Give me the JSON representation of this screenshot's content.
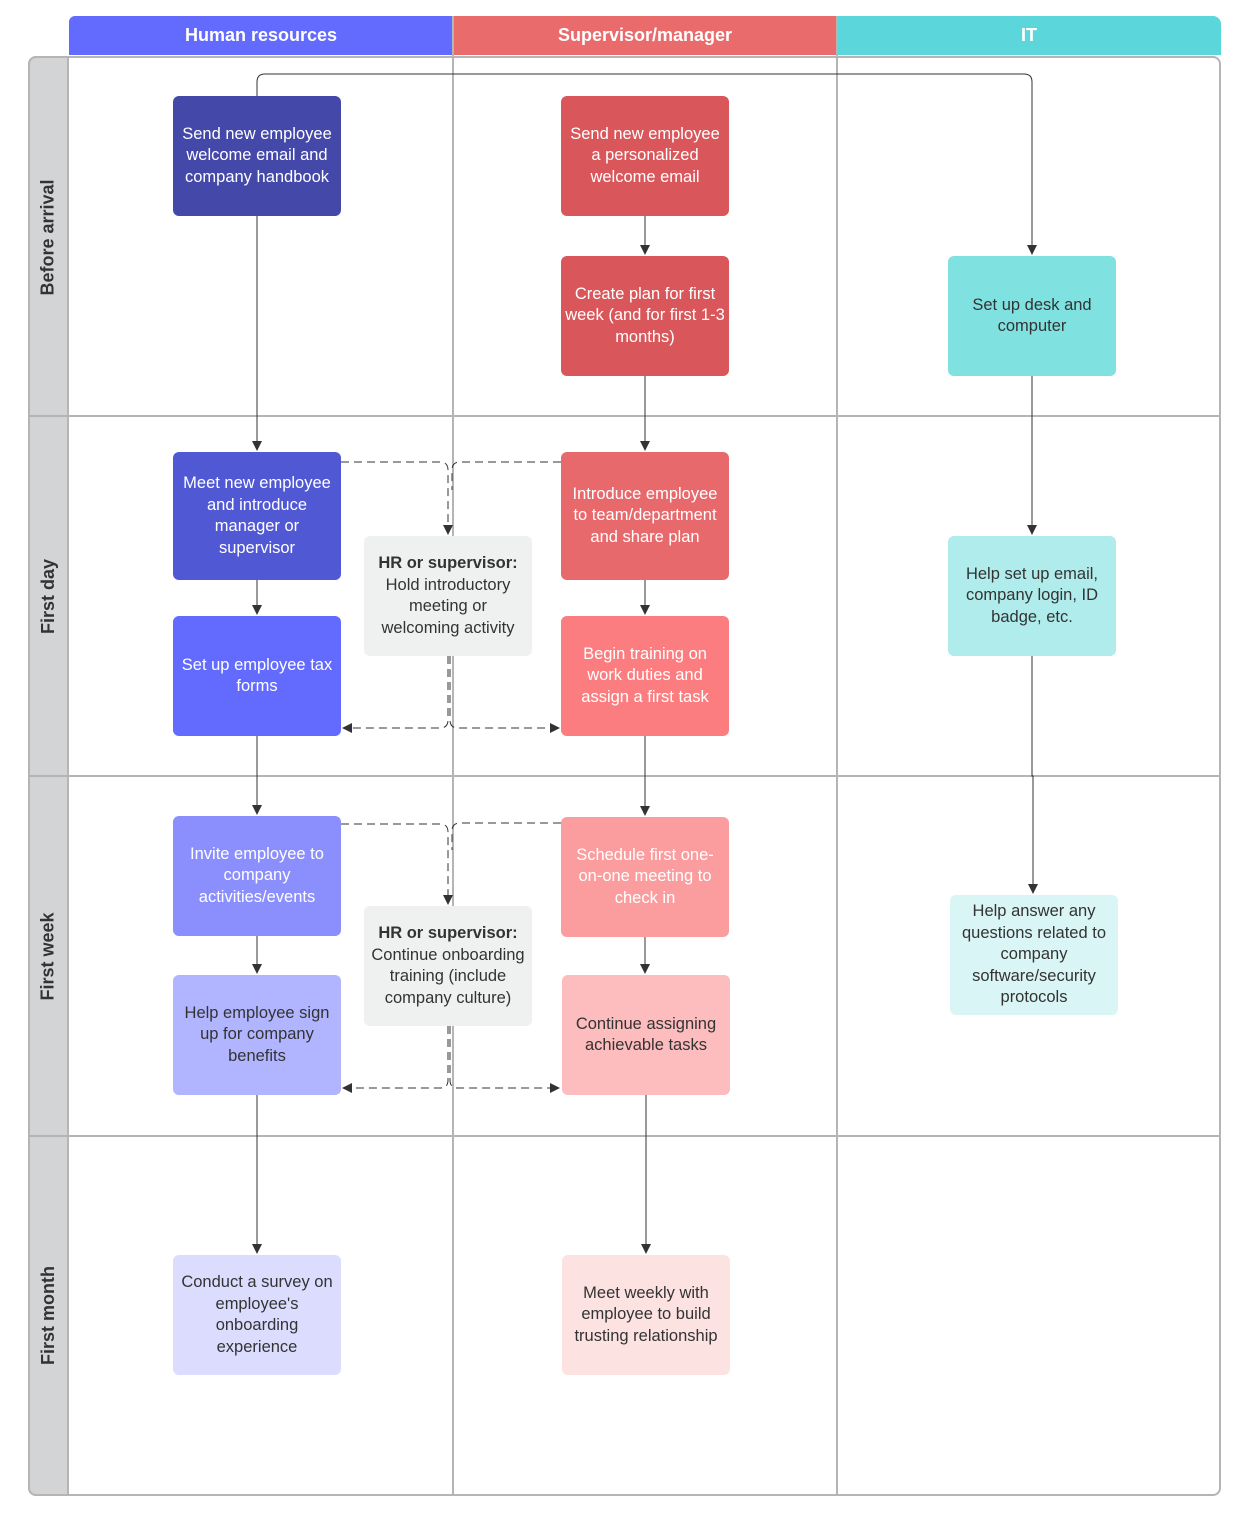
{
  "lanes": [
    {
      "id": "hr",
      "label": "Human resources",
      "color": "#636bff"
    },
    {
      "id": "sup",
      "label": "Supervisor/manager",
      "color": "#ea6b6b"
    },
    {
      "id": "it",
      "label": "IT",
      "color": "#5bd6da"
    }
  ],
  "phases": [
    {
      "label": "Before arrival"
    },
    {
      "label": "First day"
    },
    {
      "label": "First week"
    },
    {
      "label": "First month"
    }
  ],
  "nodes": {
    "hr_welcome_email": {
      "text": "Send new employee welcome email and company handbook",
      "color": "#4448a8"
    },
    "sup_personal_email": {
      "text": "Send new employee a personalized welcome email",
      "color": "#d9575a"
    },
    "sup_create_plan": {
      "text": "Create plan for first week (and for first 1-3 months)",
      "color": "#d9575a"
    },
    "it_desk_computer": {
      "text": "Set up desk and computer",
      "color": "#80e1e1"
    },
    "hr_meet_employee": {
      "text": "Meet new employee and introduce manager or supervisor",
      "color": "#5158d4"
    },
    "shared_intro_meeting": {
      "bold": "HR or supervisor:",
      "text": "Hold introductory meeting or welcoming activity",
      "color": "#eff0f0"
    },
    "sup_introduce_team": {
      "text": "Introduce employee to team/department and share plan",
      "color": "#e8696c"
    },
    "hr_tax_forms": {
      "text": "Set up employee tax forms",
      "color": "#636bff"
    },
    "sup_begin_training": {
      "text": "Begin training on work duties and assign a first task",
      "color": "#fb7d7f"
    },
    "it_email_login": {
      "text": "Help set up email, company login, ID badge, etc.",
      "color": "#b0ecec"
    },
    "hr_invite_activities": {
      "text": "Invite employee to company activities/events",
      "color": "#8b8ffd"
    },
    "shared_onboarding_training": {
      "bold": "HR or supervisor:",
      "text": "Continue onboarding training (include company culture)",
      "color": "#eff0f0"
    },
    "sup_schedule_one_on_one": {
      "text": "Schedule first one-on-one meeting to check in",
      "color": "#fb9d9e"
    },
    "hr_benefits": {
      "text": "Help employee sign up for company benefits",
      "color": "#b1b4fe"
    },
    "sup_assign_tasks": {
      "text": "Continue assigning achievable tasks",
      "color": "#fdbcbd"
    },
    "it_answer_questions": {
      "text": "Help answer any questions related to company software/security protocols",
      "color": "#daf5f5"
    },
    "hr_survey": {
      "text": "Conduct a survey on employee's onboarding experience",
      "color": "#dcddfe"
    },
    "sup_meet_weekly": {
      "text": "Meet weekly with employee to build trusting relationship",
      "color": "#fde2e2"
    }
  }
}
